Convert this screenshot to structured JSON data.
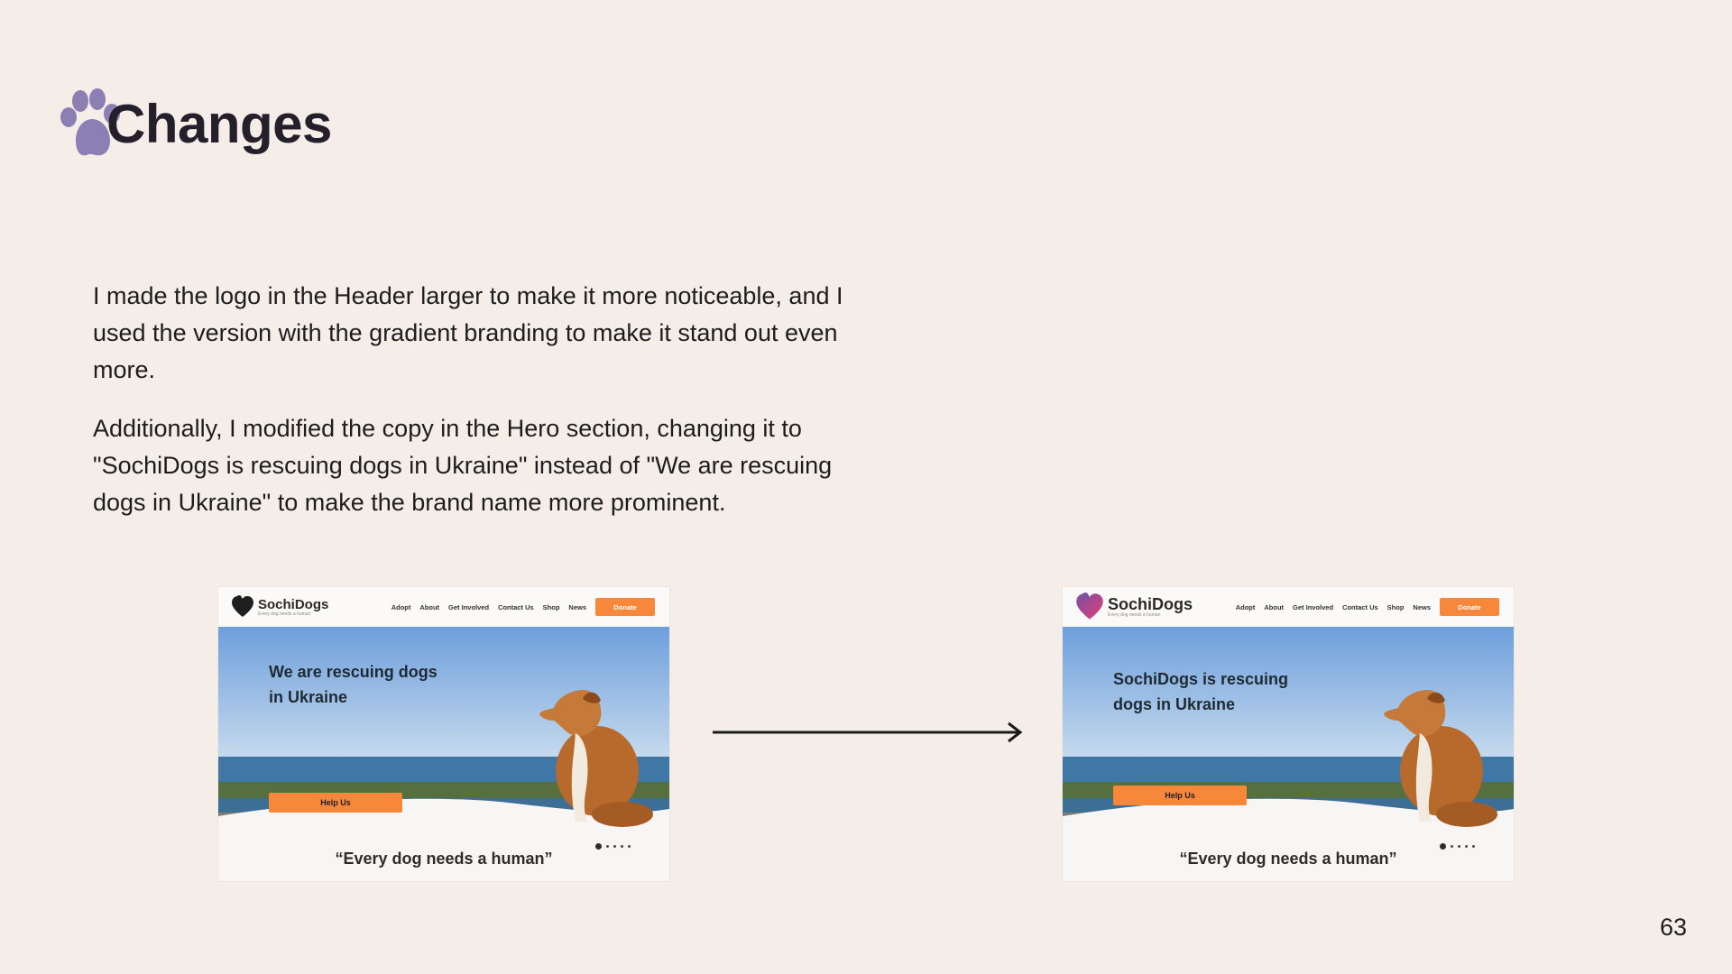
{
  "slide": {
    "title": "Changes",
    "paragraphs": [
      "I made the logo in the Header larger to make it more noticeable, and I used the version with the gradient branding to make it stand out even more.",
      "Additionally, I modified the copy in the Hero section, changing it to \"SochiDogs is rescuing dogs in Ukraine\" instead of \"We are rescuing dogs in Ukraine\" to make the brand name more prominent."
    ],
    "page_number": "63"
  },
  "mockups": {
    "before": {
      "logo_name": "SochiDogs",
      "logo_tagline": "Every dog needs a human",
      "nav": [
        "Adopt",
        "About",
        "Get Involved",
        "Contact Us",
        "Shop",
        "News"
      ],
      "donate_label": "Donate",
      "hero_heading": "We are rescuing dogs in Ukraine",
      "help_label": "Help Us",
      "quote": "“Every dog needs a human”"
    },
    "after": {
      "logo_name": "SochiDogs",
      "logo_tagline": "Every dog needs a human",
      "nav": [
        "Adopt",
        "About",
        "Get Involved",
        "Contact Us",
        "Shop",
        "News"
      ],
      "donate_label": "Donate",
      "hero_heading": "SochiDogs is rescuing dogs in Ukraine",
      "help_label": "Help Us",
      "quote": "“Every dog needs a human”"
    }
  },
  "colors": {
    "background": "#f4ede8",
    "paw": "#8c7fb3",
    "accent_orange": "#f7873a",
    "gradient_logo_start": "#7b4fa0",
    "gradient_logo_end": "#e0407a"
  },
  "icons": {
    "title": "paw-icon",
    "transition": "arrow-right-icon"
  }
}
